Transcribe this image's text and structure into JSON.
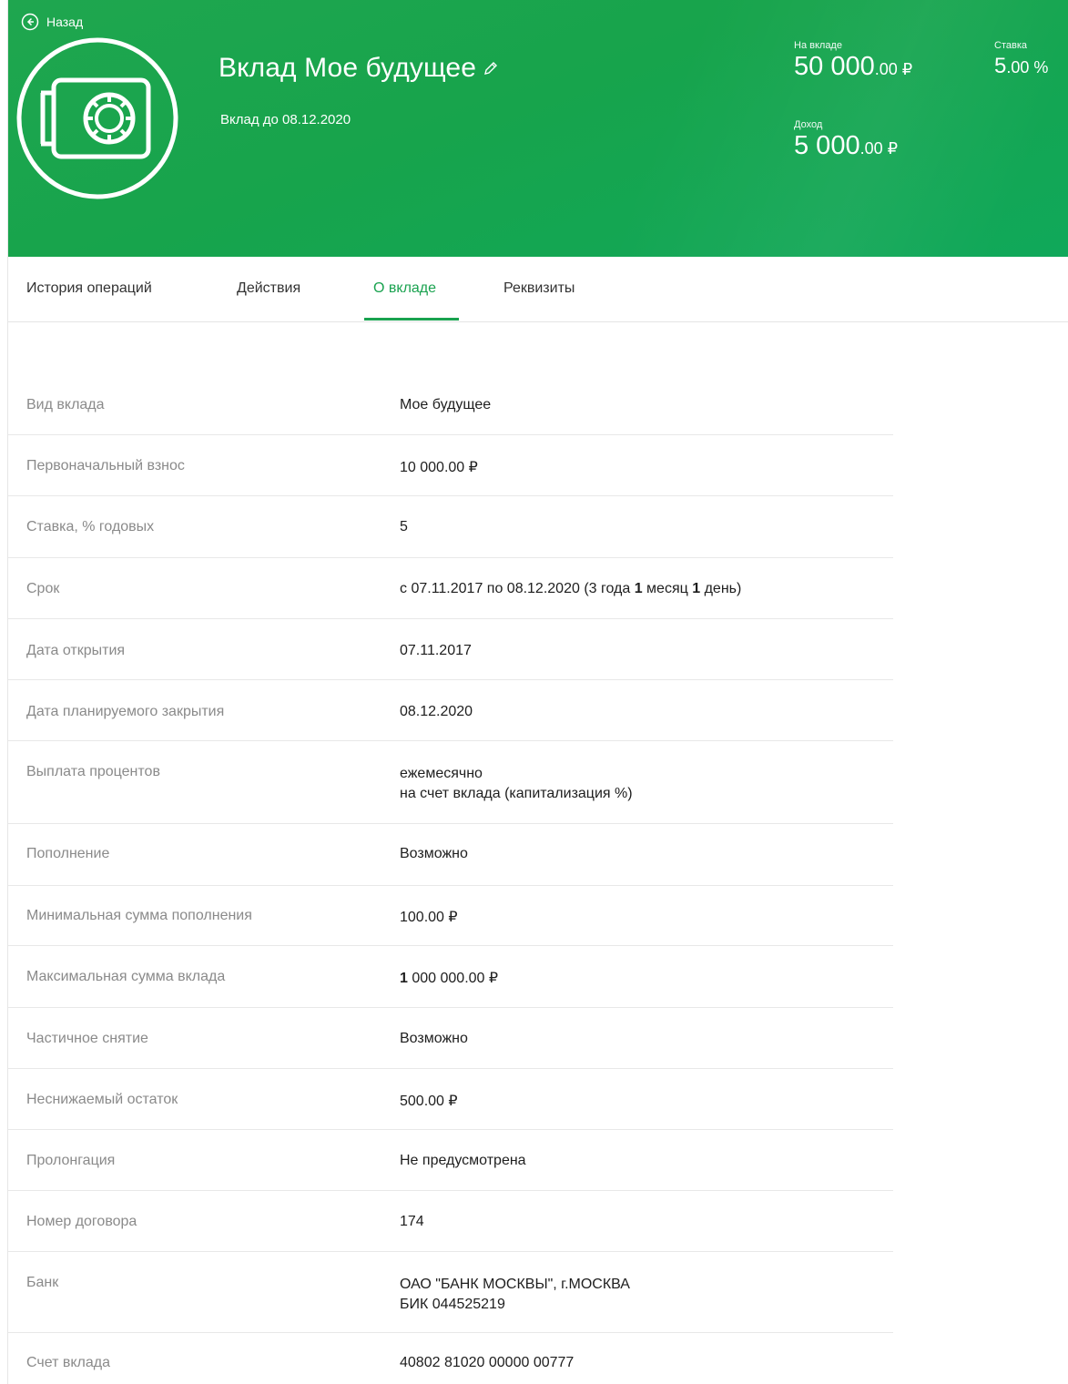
{
  "header": {
    "back_label": "Назад",
    "title": "Вклад Мое будущее",
    "subtitle": "Вклад до 08.12.2020",
    "deposit": {
      "label": "На вкладе",
      "int": "50 000",
      "frac": ".00 ₽"
    },
    "rate": {
      "label": "Ставка",
      "int": "5",
      "frac": ".00 %"
    },
    "income": {
      "label": "Доход",
      "int": "5 000",
      "frac": ".00 ₽"
    },
    "accent_color": "#19a24f"
  },
  "tabs": [
    {
      "label": "История операций",
      "active": false
    },
    {
      "label": "Действия",
      "active": false
    },
    {
      "label": "О вкладе",
      "active": true
    },
    {
      "label": "Реквизиты",
      "active": false
    }
  ],
  "details": [
    {
      "label": "Вид вклада",
      "value": "Мое будущее"
    },
    {
      "label": "Первоначальный взнос",
      "value": "10 000.00 ₽"
    },
    {
      "label": "Ставка, % годовых",
      "value": "5"
    },
    {
      "label": "Срок",
      "value_prefix": "с 07.11.2017 по 08.12.2020 (3 года ",
      "value_bold1": "1",
      "value_mid": " месяц ",
      "value_bold2": "1",
      "value_suffix": " день)"
    },
    {
      "label": "Дата открытия",
      "value": "07.11.2017"
    },
    {
      "label": "Дата планируемого закрытия",
      "value": "08.12.2020"
    },
    {
      "label": "Выплата процентов",
      "value_line1": "ежемесячно",
      "value_line2": "на счет вклада (капитализация %)"
    },
    {
      "label": "Пополнение",
      "value": "Возможно"
    },
    {
      "label": "Минимальная сумма пополнения",
      "value": "100.00 ₽"
    },
    {
      "label": "Максимальная сумма вклада",
      "value_bold": "1",
      "value": " 000 000.00 ₽"
    },
    {
      "label": "Частичное снятие",
      "value": "Возможно"
    },
    {
      "label": "Неснижаемый остаток",
      "value": "500.00 ₽"
    },
    {
      "label": "Пролонгация",
      "value": "Не предусмотрена"
    },
    {
      "label": "Номер договора",
      "value": "174"
    },
    {
      "label": "Банк",
      "value_line1": "ОАО \"БАНК МОСКВЫ\", г.МОСКВА",
      "value_line2": "БИК 044525219"
    },
    {
      "label": "Счет вклада",
      "value": "40802 81020 00000 00777"
    }
  ]
}
